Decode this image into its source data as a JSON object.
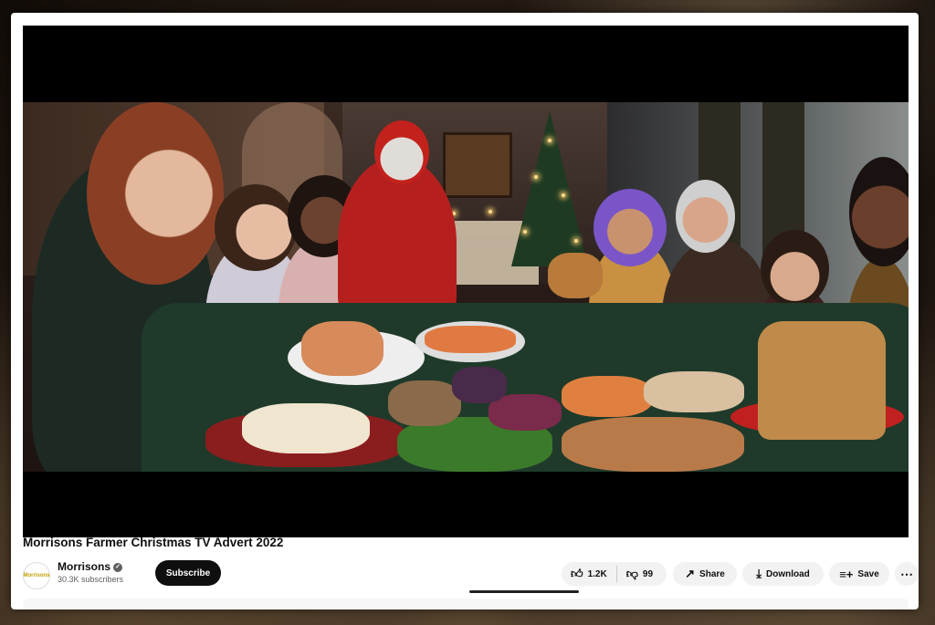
{
  "video": {
    "title": "Morrisons Farmer Christmas TV Advert 2022"
  },
  "channel": {
    "name": "Morrisons",
    "logo_text": "Morrisons",
    "verified_icon": "verified-check-icon",
    "subscribers": "30.3K subscribers",
    "subscribe_label": "Subscribe"
  },
  "actions": {
    "like_count": "1.2K",
    "dislike_count": "99",
    "share_label": "Share",
    "download_label": "Download",
    "save_label": "Save",
    "more_icon": "more-horizontal-icon"
  },
  "colors": {
    "subscribe_bg": "#0f0f0f",
    "pill_bg": "#f2f2f2",
    "table_green": "#1f3a2a"
  }
}
